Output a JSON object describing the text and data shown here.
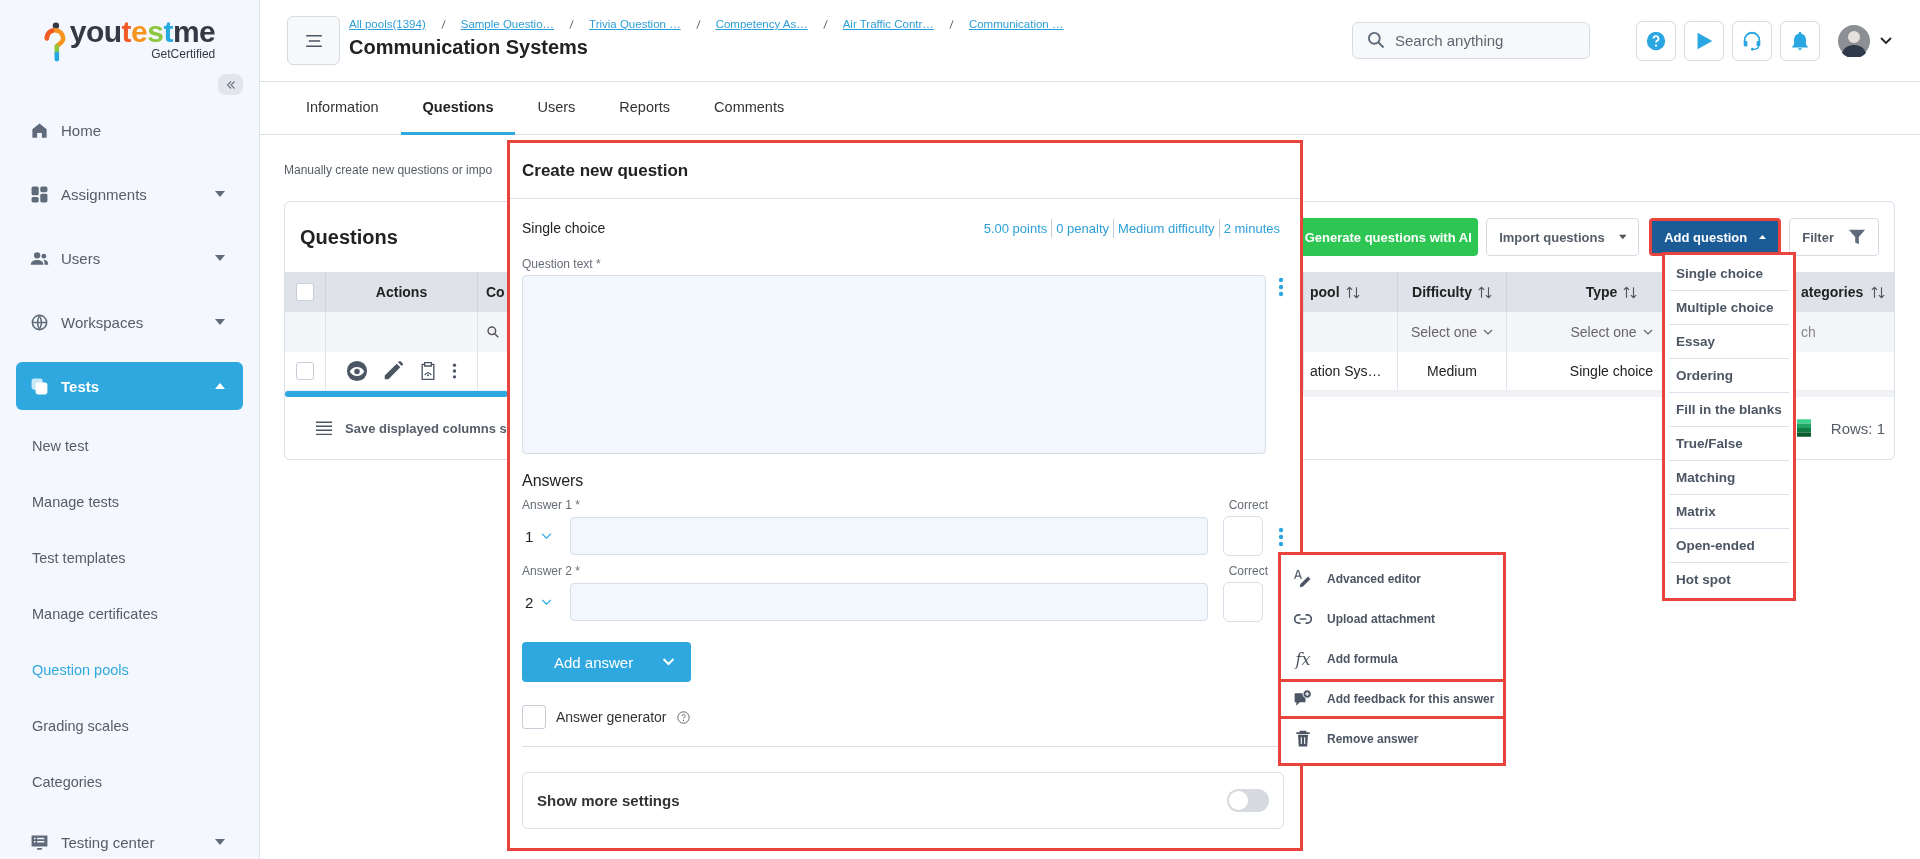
{
  "logo": {
    "parts": [
      {
        "text": "you",
        "color": "#333a45"
      },
      {
        "text": "t",
        "color": "#f15a29"
      },
      {
        "text": "e",
        "color": "#f7941d"
      },
      {
        "text": "s",
        "color": "#8dc63f"
      },
      {
        "text": "t",
        "color": "#27aae1"
      },
      {
        "text": "me",
        "color": "#333a45"
      }
    ],
    "tagline": "GetCertified"
  },
  "sidebar": {
    "items": [
      {
        "label": "Home",
        "kind": "link",
        "selected": false
      },
      {
        "label": "Assignments",
        "kind": "group",
        "selected": false,
        "expanded": false
      },
      {
        "label": "Users",
        "kind": "group",
        "selected": false,
        "expanded": false
      },
      {
        "label": "Workspaces",
        "kind": "group",
        "selected": false,
        "expanded": false
      },
      {
        "label": "Tests",
        "kind": "group",
        "selected": true,
        "expanded": true,
        "children": [
          {
            "label": "New test",
            "selected": false
          },
          {
            "label": "Manage tests",
            "selected": false
          },
          {
            "label": "Test templates",
            "selected": false
          },
          {
            "label": "Manage certificates",
            "selected": false
          },
          {
            "label": "Question pools",
            "selected": true
          },
          {
            "label": "Grading scales",
            "selected": false
          },
          {
            "label": "Categories",
            "selected": false
          }
        ]
      },
      {
        "label": "Testing center",
        "kind": "group",
        "selected": false,
        "expanded": false
      }
    ]
  },
  "header": {
    "breadcrumbs": [
      "All pools(1394)",
      "Sample Questio…",
      "Trivia Question …",
      "Competency As…",
      "Air Traffic Contr…",
      "Communication …"
    ],
    "title": "Communication Systems",
    "search": {
      "placeholder": "Search anything"
    }
  },
  "tabs": [
    {
      "label": "Information",
      "selected": false
    },
    {
      "label": "Questions",
      "selected": true
    },
    {
      "label": "Users",
      "selected": false
    },
    {
      "label": "Reports",
      "selected": false
    },
    {
      "label": "Comments",
      "selected": false
    }
  ],
  "description": "Manually create new questions or impo",
  "questions_card": {
    "title": "Questions",
    "buttons": [
      {
        "label": "Generate questions with AI",
        "kind": "ai"
      },
      {
        "label": "Import questions",
        "kind": "dropdown"
      },
      {
        "label": "Add question",
        "kind": "primary",
        "expanded": true,
        "highlighted": true
      },
      {
        "label": "Filter",
        "kind": "filter"
      }
    ],
    "table": {
      "all_checked": false,
      "columns": [
        {
          "label": "Actions",
          "sortable": false
        },
        {
          "label": "Co"
        },
        {
          "label": "pool",
          "sortable": true
        },
        {
          "label": "Difficulty",
          "sortable": true
        },
        {
          "label": "Type",
          "sortable": true
        },
        {
          "label": "ategories",
          "sortable": true
        }
      ],
      "filters": {
        "difficulty": "Select one",
        "type": "Select one",
        "categories": "ch"
      },
      "rows": [
        {
          "checked": false,
          "pool": "ation Sys…",
          "difficulty": "Medium",
          "type": "Single choice"
        }
      ]
    },
    "footer": {
      "save_label": "Save displayed columns s",
      "rows": "Rows: 1"
    }
  },
  "add_question_menu": {
    "highlighted": true,
    "items": [
      "Single choice",
      "Multiple choice",
      "Essay",
      "Ordering",
      "Fill in the blanks",
      "True/False",
      "Matching",
      "Matrix",
      "Open-ended",
      "Hot spot"
    ]
  },
  "modal": {
    "title": "Create new question",
    "highlighted": true,
    "question_type": "Single choice",
    "meta": [
      "5.00 points",
      "0 penalty",
      "Medium difficulty",
      "2 minutes"
    ],
    "question_label": "Question text *",
    "answers_heading": "Answers",
    "answers": [
      {
        "label": "Answer 1 *",
        "correct_label": "Correct",
        "number": "1",
        "correct": false
      },
      {
        "label": "Answer 2 *",
        "correct_label": "Correct",
        "number": "2",
        "correct": false
      }
    ],
    "add_answer": "Add answer",
    "answer_generator": {
      "label": "Answer generator",
      "checked": false
    },
    "more_settings": {
      "label": "Show more settings",
      "on": false
    }
  },
  "answer_menu": {
    "highlighted": true,
    "items": [
      {
        "label": "Advanced editor",
        "highlighted": false
      },
      {
        "label": "Upload attachment",
        "highlighted": false
      },
      {
        "label": "Add formula",
        "symbol": "fx",
        "highlighted": false
      },
      {
        "label": "Add feedback for this answer",
        "highlighted": true
      },
      {
        "label": "Remove answer",
        "highlighted": false
      }
    ]
  }
}
